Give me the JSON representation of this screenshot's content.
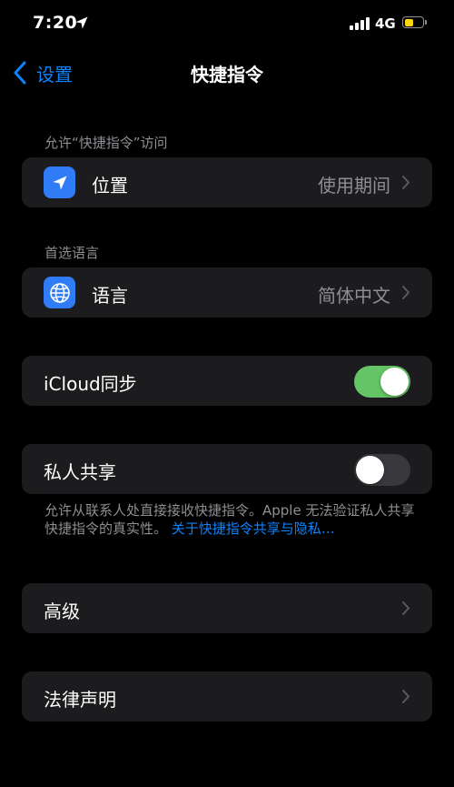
{
  "status_bar": {
    "time": "7:20",
    "network": "4G"
  },
  "nav": {
    "back_label": "设置",
    "title": "快捷指令"
  },
  "sections": {
    "access_header": "允许“快捷指令”访问",
    "location": {
      "label": "位置",
      "value": "使用期间",
      "icon": "location-arrow-icon"
    },
    "language_header": "首选语言",
    "language": {
      "label": "语言",
      "value": "简体中文",
      "icon": "globe-icon"
    },
    "icloud_sync": {
      "label": "iCloud同步",
      "enabled": true
    },
    "private_sharing": {
      "label": "私人共享",
      "enabled": false
    },
    "private_note": "允许从联系人处直接接收快捷指令。Apple 无法验证私人共享快捷指令的真实性。",
    "private_link": "关于快捷指令共享与隐私…",
    "advanced": {
      "label": "高级"
    },
    "legal": {
      "label": "法律声明"
    }
  },
  "colors": {
    "background": "#000000",
    "cell": "#1c1c1e",
    "accent": "#0a84ff",
    "toggle_on": "#65c466",
    "toggle_off": "#39393d",
    "secondary_text": "#8e8e93",
    "icon_bg": "#2f7cf6",
    "battery": "#ffd60a"
  },
  "battery_level": 0.55
}
